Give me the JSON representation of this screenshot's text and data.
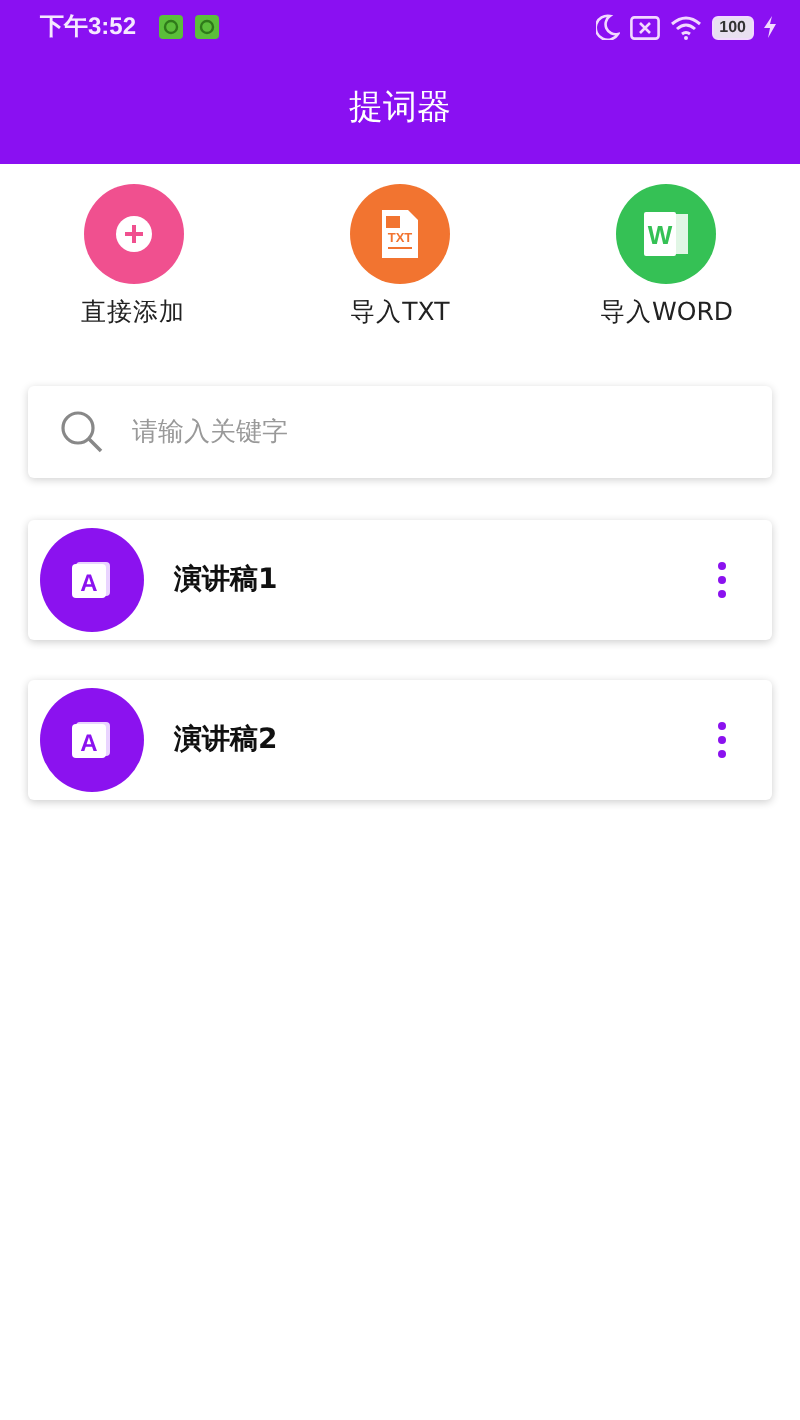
{
  "status_bar": {
    "time": "下午3:52",
    "battery": "100"
  },
  "header": {
    "title": "提词器"
  },
  "actions": [
    {
      "kind": "add",
      "label": "直接添加",
      "color": "#f0508f"
    },
    {
      "kind": "txt",
      "label": "导入TXT",
      "glyph": "TXT",
      "color": "#f27430"
    },
    {
      "kind": "word",
      "label": "导入WORD",
      "glyph": "W",
      "color": "#35c155"
    }
  ],
  "search": {
    "placeholder": "请输入关键字"
  },
  "scripts": [
    {
      "title": "演讲稿1",
      "glyph": "A"
    },
    {
      "title": "演讲稿2",
      "glyph": "A"
    }
  ]
}
